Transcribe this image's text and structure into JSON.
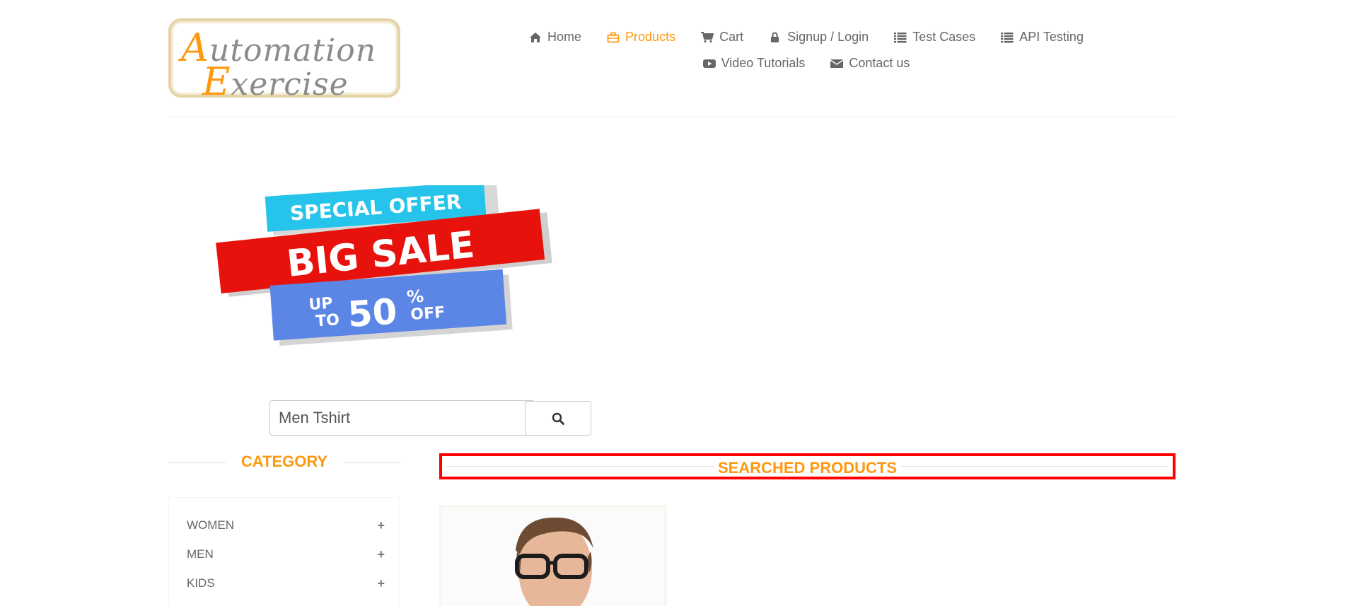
{
  "logo": {
    "line1_cap": "A",
    "line1_rest": "utomation",
    "line2_cap": "E",
    "line2_rest": "xercise"
  },
  "nav": {
    "home": "Home",
    "products": "Products",
    "cart": "Cart",
    "signup_login": "Signup / Login",
    "test_cases": "Test Cases",
    "api_testing": "API Testing",
    "video_tutorials": "Video Tutorials",
    "contact_us": "Contact us"
  },
  "banner": {
    "line1": "SPECIAL OFFER",
    "line2": "BIG SALE",
    "up": "UP",
    "to": "TO",
    "percent_value": "50",
    "percent_sign": "%",
    "off": "OFF"
  },
  "search": {
    "value": "Men Tshirt"
  },
  "category": {
    "title": "CATEGORY",
    "items": [
      {
        "label": "WOMEN",
        "toggle": "+"
      },
      {
        "label": "MEN",
        "toggle": "+"
      },
      {
        "label": "KIDS",
        "toggle": "+"
      }
    ]
  },
  "results": {
    "title": "SEARCHED PRODUCTS"
  },
  "colors": {
    "accent": "#fe980f",
    "highlight_border": "#ff0000",
    "text": "#696763"
  }
}
